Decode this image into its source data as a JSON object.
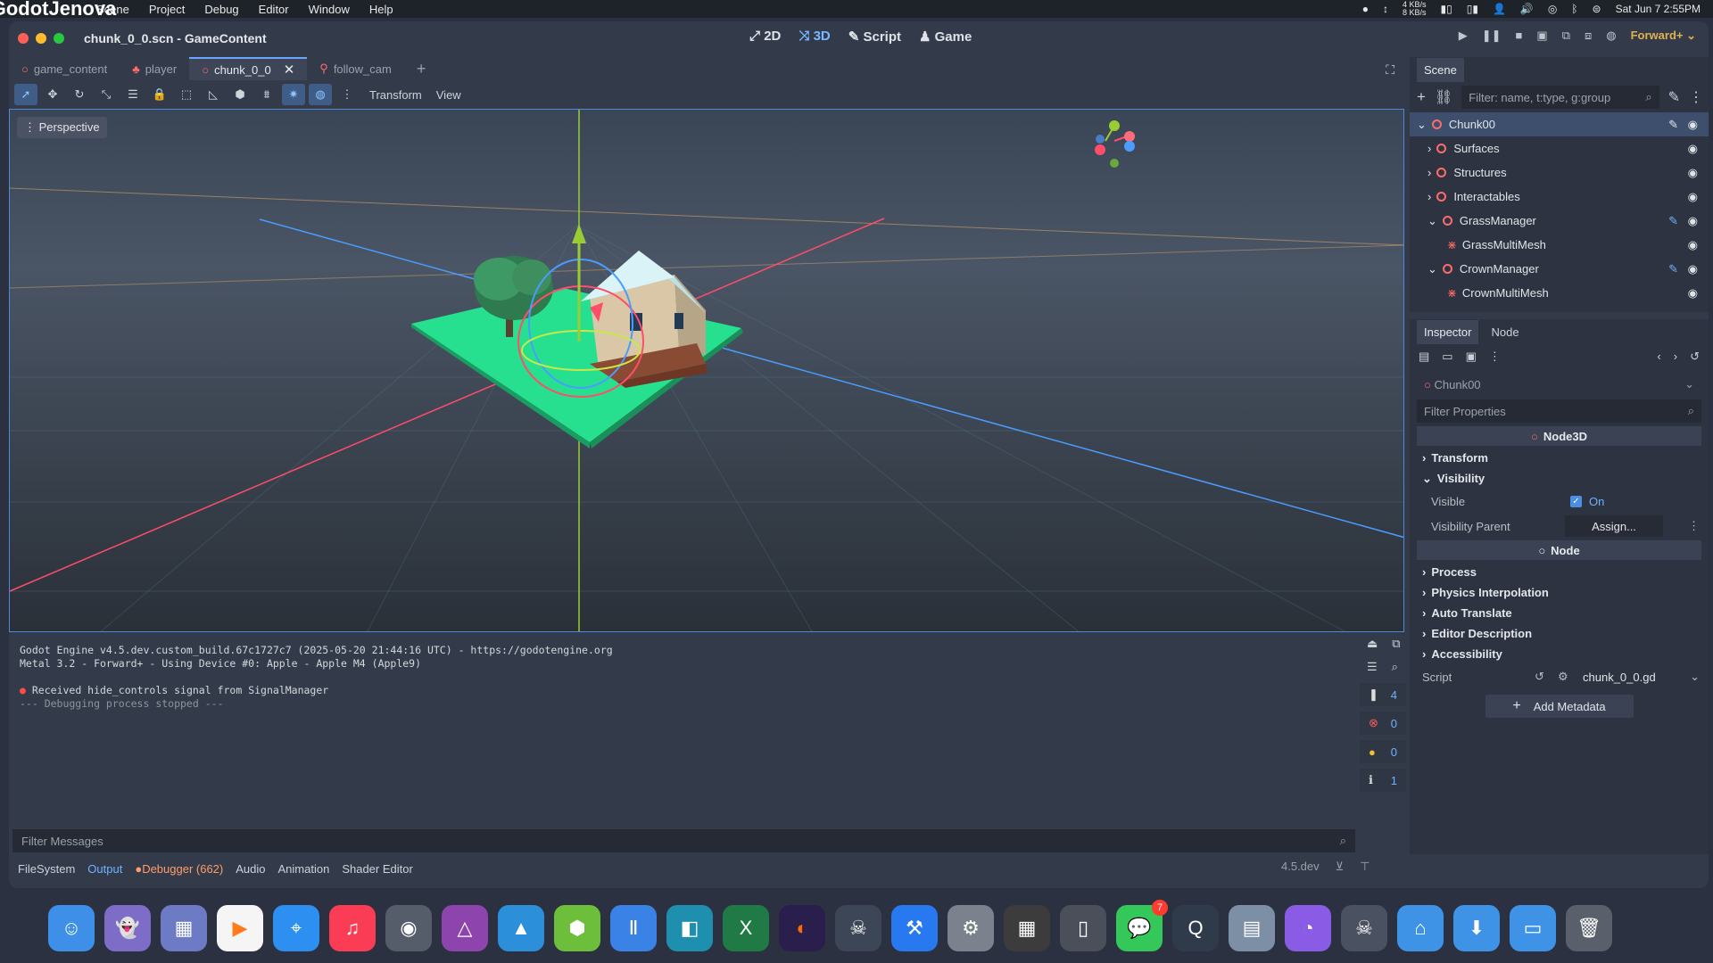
{
  "menubar": {
    "app": "GodotJenova",
    "items": [
      "Scene",
      "Project",
      "Debug",
      "Editor",
      "Window",
      "Help"
    ],
    "net_up": "4 KB/s",
    "net_down": "8 KB/s",
    "clock": "Sat Jun 7  2:55PM"
  },
  "window": {
    "title": "chunk_0_0.scn - GameContent",
    "modes": [
      {
        "label": "2D",
        "icon": "2d-icon"
      },
      {
        "label": "3D",
        "icon": "3d-icon"
      },
      {
        "label": "Script",
        "icon": "script-icon"
      },
      {
        "label": "Game",
        "icon": "game-icon"
      }
    ],
    "renderer": "Forward+"
  },
  "scene_tabs": [
    "game_content",
    "player",
    "chunk_0_0",
    "follow_cam"
  ],
  "viewport": {
    "toolbar_menus": [
      "Transform",
      "View"
    ],
    "perspective_label": "Perspective"
  },
  "output": {
    "lines": [
      "Godot Engine v4.5.dev.custom_build.67c1727c7 (2025-05-20 21:44:16 UTC) - https://godotengine.org",
      "Metal 3.2 - Forward+ - Using Device #0: Apple - Apple M4 (Apple9)",
      "",
      "Received hide_controls signal from SignalManager",
      "--- Debugging process stopped ---"
    ],
    "counts": {
      "messages": "4",
      "errors": "0",
      "warnings": "0",
      "info": "1"
    },
    "filter_placeholder": "Filter Messages"
  },
  "bottom_panel": {
    "tabs": [
      "FileSystem",
      "Output",
      "Debugger (662)",
      "Audio",
      "Animation",
      "Shader Editor"
    ],
    "version": "4.5.dev"
  },
  "scene_dock": {
    "title": "Scene",
    "filter_placeholder": "Filter: name, t:type, g:group",
    "nodes": [
      "Chunk00",
      "Surfaces",
      "Structures",
      "Interactables",
      "GrassManager",
      "GrassMultiMesh",
      "CrownManager",
      "CrownMultiMesh"
    ]
  },
  "inspector": {
    "tabs": [
      "Inspector",
      "Node"
    ],
    "object": "Chunk00",
    "filter_placeholder": "Filter Properties",
    "class_header": "Node3D",
    "sections": [
      "Transform",
      "Visibility"
    ],
    "visible_label": "Visible",
    "visible_value": "On",
    "visibility_parent_label": "Visibility Parent",
    "assign": "Assign...",
    "node_header": "Node",
    "node_sections": [
      "Process",
      "Physics Interpolation",
      "Auto Translate",
      "Editor Description",
      "Accessibility"
    ],
    "script_label": "Script",
    "script_value": "chunk_0_0.gd",
    "add_metadata": "Add Metadata"
  },
  "dock_badge": "7"
}
